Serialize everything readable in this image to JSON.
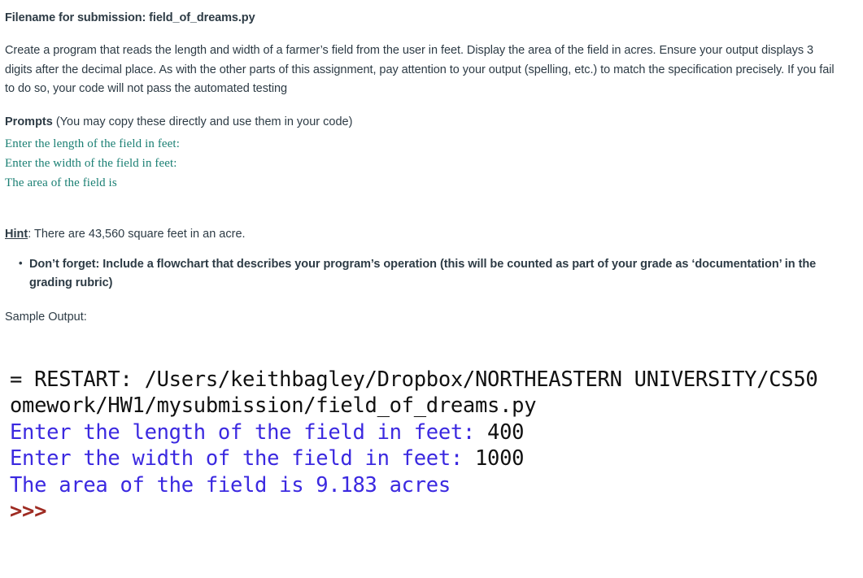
{
  "document": {
    "filename_line": "Filename for submission: field_of_dreams.py",
    "description": "Create a program that reads the length and width of a farmer’s field from the user in feet. Display the area of the field in acres. Ensure your output displays 3 digits after the decimal place. As with the other parts of this assignment, pay attention to your output (spelling, etc.) to match the specification precisely. If you fail to do so, your code will not pass the automated testing",
    "prompts_section": {
      "label": "Prompts",
      "note": " (You may copy these directly and use them in your code)",
      "lines": [
        "Enter the length of the field in feet:",
        "Enter the width of the field in feet:",
        "The area of the field is"
      ],
      "color": "#1a7f73"
    },
    "hint": {
      "label": "Hint",
      "text": ": There are 43,560 square feet in an acre."
    },
    "bullets": [
      "Don’t forget: Include a flowchart that describes your program’s operation (this will be counted as part of your grade as ‘documentation’ in the grading rubric)"
    ],
    "sample_output_label": "Sample Output:",
    "console": {
      "restart_line_1": "= RESTART: /Users/keithbagley/Dropbox/NORTHEASTERN UNIVERSITY/CS50",
      "restart_line_2": "omework/HW1/mysubmission/field_of_dreams.py",
      "prompt_length": "Enter the length of the field in feet: ",
      "value_length": "400",
      "prompt_width": "Enter the width of the field in feet: ",
      "value_width": "1000",
      "result_line": "The area of the field is 9.183 acres",
      "shell_prompt": ">>>",
      "colors": {
        "output_black": "#111111",
        "output_blue": "#3b29e0",
        "shell_red": "#9e2b22"
      }
    }
  }
}
